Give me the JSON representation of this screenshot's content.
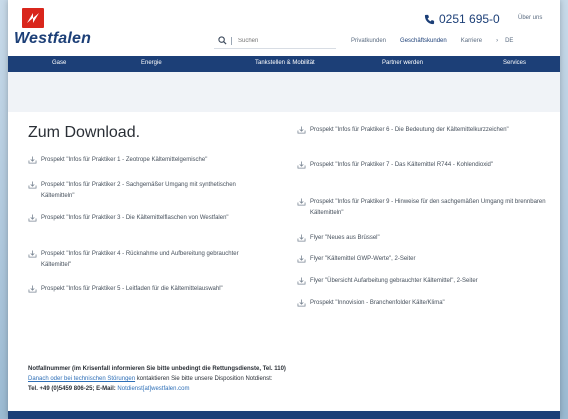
{
  "header": {
    "brand": "Westfalen",
    "phone": "0251 695-0",
    "ueber_uns": "Über uns",
    "search_placeholder": "Suchen",
    "links": [
      "Privatkunden",
      "Geschäftskunden",
      "Karriere"
    ],
    "lang_separator": "›",
    "lang": "DE"
  },
  "nav": {
    "items": [
      "Gase",
      "Energie",
      "Tankstellen & Mobilität",
      "Partner werden",
      "Services"
    ]
  },
  "main": {
    "title": "Zum Download.",
    "left_items": [
      "Prospekt \"Infos für Praktiker 1 - Zeotrope Kältemittelgemische\"",
      "Prospekt \"Infos für Praktiker 2 - Sachgemäßer Umgang mit synthetischen Kältemitteln\"",
      "Prospekt \"Infos für Praktiker 3 - Die Kältemittelflaschen von Westfalen\"",
      "Prospekt \"Infos für Praktiker 4 - Rücknahme und Aufbereitung gebrauchter Kältemittel\"",
      "Prospekt \"Infos für Praktiker 5 - Leitfaden für die Kältemittelauswahl\""
    ],
    "right_items": [
      "Prospekt \"Infos für Praktiker 6 - Die Bedeutung der Kältemittelkurzzeichen\"",
      "Prospekt \"Infos für Praktiker 7 - Das Kältemittel R744 - Kohlendioxid\"",
      "Prospekt \"Infos für Praktiker 9 - Hinweise für den sachgemäßen Umgang mit brennbaren Kältemitteln\"",
      "Flyer \"Neues aus Brüssel\"",
      "Flyer \"Kältemittel GWP-Werte\", 2-Seiter",
      "Flyer \"Übersicht Aufarbeitung gebrauchter Kältemittel\", 2-Seiter",
      "Prospekt \"Innovision - Branchenfolder Kälte/Klima\""
    ]
  },
  "notfall": {
    "heading": "Notfallnummer (im Krisenfall informieren Sie bitte unbedingt die Rettungsdienste, Tel. 110)",
    "link": "Danach oder bei technischen Störungen",
    "line2_rest": " kontaktieren Sie bitte unsere Disposition Notdienst:",
    "tel_label": "Tel. +49 (0)5459 806-25; E-Mail:",
    "email": " Notdienst[at]westfalen.com"
  },
  "colors": {
    "brand_blue": "#1c3f77",
    "brand_red": "#d9261c",
    "link_blue": "#2e6fb7"
  }
}
